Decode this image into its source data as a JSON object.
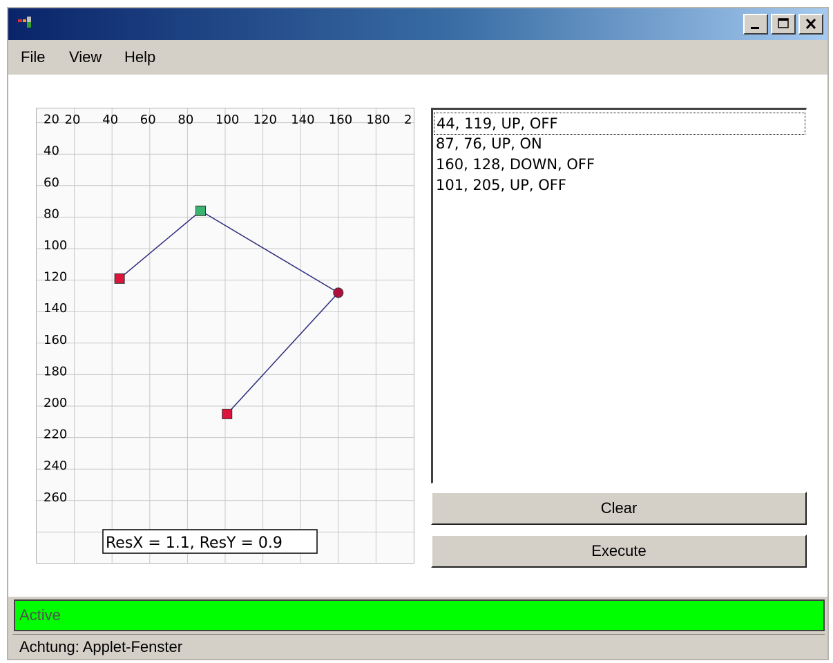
{
  "menu": {
    "file": "File",
    "view": "View",
    "help": "Help"
  },
  "graph": {
    "x_ticks": [
      "20",
      "40",
      "60",
      "80",
      "100",
      "120",
      "140",
      "160",
      "180",
      "2"
    ],
    "y_ticks": [
      "20",
      "40",
      "60",
      "80",
      "100",
      "120",
      "140",
      "160",
      "180",
      "200",
      "220",
      "240",
      "260"
    ],
    "points": [
      {
        "x": 44,
        "y": 119,
        "shape": "square",
        "color": "#dc143c"
      },
      {
        "x": 87,
        "y": 76,
        "shape": "square",
        "color": "#3cb371"
      },
      {
        "x": 160,
        "y": 128,
        "shape": "circle",
        "color": "#b0103c"
      },
      {
        "x": 101,
        "y": 205,
        "shape": "square",
        "color": "#dc143c"
      }
    ],
    "resolution_label": "ResX = 1.1, ResY = 0.9",
    "line_color": "#2a2a7a"
  },
  "list": {
    "items": [
      "44, 119, UP, OFF",
      "87, 76, UP, ON",
      "160, 128, DOWN, OFF",
      "101, 205, UP, OFF"
    ],
    "selected_index": 0
  },
  "buttons": {
    "clear": "Clear",
    "execute": "Execute"
  },
  "status": {
    "text": "Active",
    "color": "#00ff00"
  },
  "warning": "Achtung: Applet-Fenster"
}
